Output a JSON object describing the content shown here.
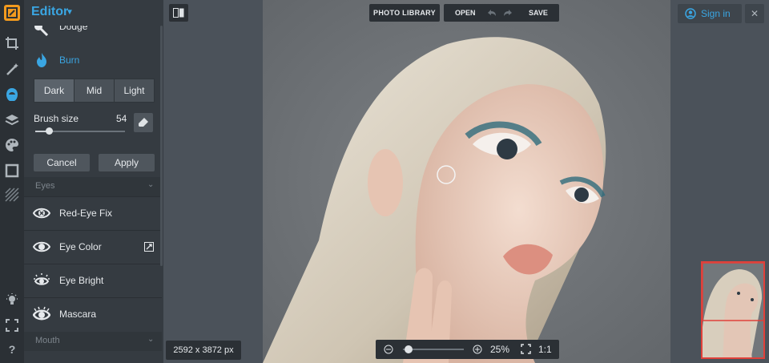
{
  "app": {
    "title": "Editor",
    "accent": "#3aa6e3",
    "background": "#4b525a"
  },
  "rail": {
    "icons": [
      "logo-icon",
      "crop-icon",
      "magic-wand-icon",
      "head-icon",
      "layers-icon",
      "palette-icon",
      "frame-icon",
      "texture-icon",
      "lightbulb-icon",
      "fullscreen-icon",
      "help-icon"
    ],
    "help_label": "?"
  },
  "panel": {
    "dodge_label": "Dodge",
    "burn_label": "Burn",
    "modes": [
      "Dark",
      "Mid",
      "Light"
    ],
    "selected_mode": "Dark",
    "brush_size_label": "Brush size",
    "brush_size_value": "54",
    "brush_size_fraction": 0.15,
    "cancel_label": "Cancel",
    "apply_label": "Apply",
    "eyes_section": "Eyes",
    "eye_tools": [
      "Red-Eye Fix",
      "Eye Color",
      "Eye Bright",
      "Mascara"
    ],
    "mouth_section": "Mouth"
  },
  "toolbar": {
    "compare_icon": "compare-icon",
    "photo_library_label": "PHOTO LIBRARY",
    "open_label": "OPEN",
    "save_label": "SAVE",
    "sign_in_label": "Sign in",
    "close_label": "✕"
  },
  "status": {
    "dimensions": "2592 x 3872 px",
    "zoom_level": "25%",
    "zoom_fraction": 0.05,
    "one_to_one_label": "1:1"
  }
}
